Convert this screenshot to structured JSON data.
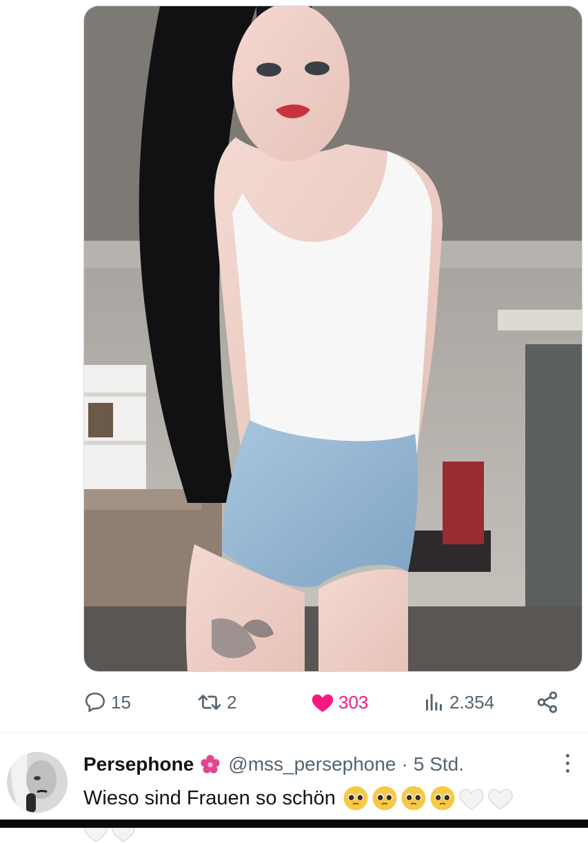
{
  "tweet": {
    "media": {
      "description_icon": "photo"
    },
    "actions": {
      "replies": {
        "icon": "comment-icon",
        "count": "15"
      },
      "retweets": {
        "icon": "retweet-icon",
        "count": "2"
      },
      "likes": {
        "icon": "heart-icon",
        "count": "303",
        "liked": true
      },
      "views": {
        "icon": "views-chart-icon",
        "count": "2.354"
      },
      "share": {
        "icon": "share-icon"
      }
    }
  },
  "reply": {
    "name": "Persephone",
    "name_badge_icon": "blossom-icon",
    "handle": "@mss_persephone",
    "separator": "·",
    "time": "5 Std.",
    "text": "Wieso sind Frauen so schön",
    "emojis": [
      "pleading-face",
      "pleading-face",
      "pleading-face",
      "pleading-face",
      "white-heart",
      "white-heart"
    ],
    "emojis_wrapped": [
      "white-heart",
      "white-heart"
    ]
  },
  "colors": {
    "like_pink": "#f91880",
    "secondary_text": "#536471",
    "primary_text": "#0f1419",
    "divider": "#eff3f4"
  }
}
